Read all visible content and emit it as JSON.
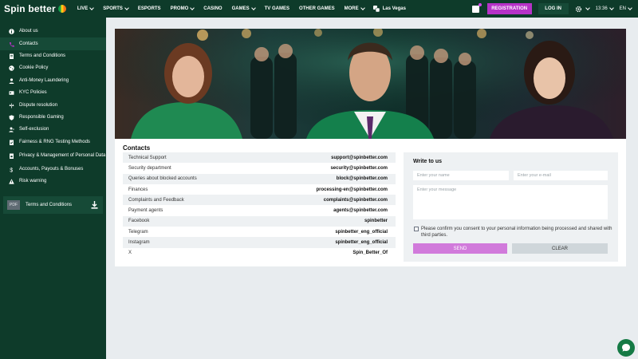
{
  "brand": {
    "logo_text": "Spin better",
    "colors": {
      "header_bg": "#0e3b2a",
      "accent": "#b632c7",
      "send": "#d17adb"
    }
  },
  "nav": {
    "items": [
      {
        "label": "LIVE",
        "dropdown": true
      },
      {
        "label": "SPORTS",
        "dropdown": true
      },
      {
        "label": "ESPORTS",
        "dropdown": false
      },
      {
        "label": "PROMO",
        "dropdown": true
      },
      {
        "label": "CASINO",
        "dropdown": false
      },
      {
        "label": "GAMES",
        "dropdown": true
      },
      {
        "label": "TV GAMES",
        "dropdown": false
      },
      {
        "label": "OTHER GAMES",
        "dropdown": false
      },
      {
        "label": "MORE",
        "dropdown": true
      }
    ],
    "las_vegas": "Las Vegas",
    "registration": "REGISTRATION",
    "login": "LOG IN",
    "time": "13:36",
    "language": "EN"
  },
  "sidebar": {
    "items": [
      {
        "label": "About us",
        "icon": "info-icon"
      },
      {
        "label": "Contacts",
        "icon": "phone-icon",
        "active": true
      },
      {
        "label": "Terms and Conditions",
        "icon": "document-icon"
      },
      {
        "label": "Cookie Policy",
        "icon": "cookie-icon"
      },
      {
        "label": "Anti-Money Laundering",
        "icon": "person-icon"
      },
      {
        "label": "KYC Policies",
        "icon": "id-icon"
      },
      {
        "label": "Dispute resolution",
        "icon": "scales-icon"
      },
      {
        "label": "Responsible Gaming",
        "icon": "shield-icon"
      },
      {
        "label": "Self-exclusion",
        "icon": "user-block-icon"
      },
      {
        "label": "Fairness & RNG Testing Methods",
        "icon": "check-doc-icon"
      },
      {
        "label": "Privacy & Management of Personal Data",
        "icon": "lock-doc-icon"
      },
      {
        "label": "Accounts, Payouts & Bonuses",
        "icon": "dollar-icon"
      },
      {
        "label": "Risk warning",
        "icon": "warning-icon"
      }
    ],
    "pdf": {
      "badge": "PDF",
      "label": "Terms and Conditions"
    }
  },
  "contacts": {
    "title": "Contacts",
    "rows": [
      {
        "label": "Technical Support",
        "value": "support@spinbetter.com"
      },
      {
        "label": "Security department",
        "value": "security@spinbetter.com"
      },
      {
        "label": "Queries about blocked accounts",
        "value": "block@spinbetter.com"
      },
      {
        "label": "Finances",
        "value": "processing-en@spinbetter.com"
      },
      {
        "label": "Complaints and Feedback",
        "value": "complaints@spinbetter.com"
      },
      {
        "label": "Payment agents",
        "value": "agents@spinbetter.com"
      },
      {
        "label": "Facebook",
        "value": "spinbetter"
      },
      {
        "label": "Telegram",
        "value": "spinbetter_eng_official"
      },
      {
        "label": "Instagram",
        "value": "spinbetter_eng_official"
      },
      {
        "label": "X",
        "value": "Spin_Better_Of"
      }
    ]
  },
  "form": {
    "title": "Write to us",
    "name_placeholder": "Enter your name",
    "email_placeholder": "Enter your e-mail",
    "message_placeholder": "Enter your message",
    "consent": "Please confirm you consent to your personal information being processed and shared with third parties.",
    "send": "SEND",
    "clear": "CLEAR"
  }
}
